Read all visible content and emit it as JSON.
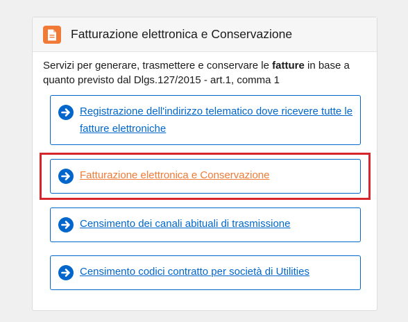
{
  "card": {
    "title": "Fatturazione elettronica e Conservazione",
    "description_before": "Servizi per generare, trasmettere e conservare le ",
    "description_bold": "fatture",
    "description_after": " in base a quanto previsto dal Dlgs.127/2015 - art.1, comma 1"
  },
  "links": [
    {
      "label": "Registrazione dell'indirizzo telematico dove ricevere tutte le fatture elettroniche"
    },
    {
      "label": "Fatturazione elettronica e Conservazione"
    },
    {
      "label": "Censimento dei canali abituali di trasmissione"
    },
    {
      "label": "Censimento codici contratto per società di Utilities"
    }
  ],
  "colors": {
    "link": "#0066cc",
    "active_link": "#f07a36",
    "highlight_border": "#d6262b",
    "header_icon": "#f07a36"
  },
  "icons": {
    "header": "document-icon",
    "links": "arrow-right-circle-icon"
  }
}
